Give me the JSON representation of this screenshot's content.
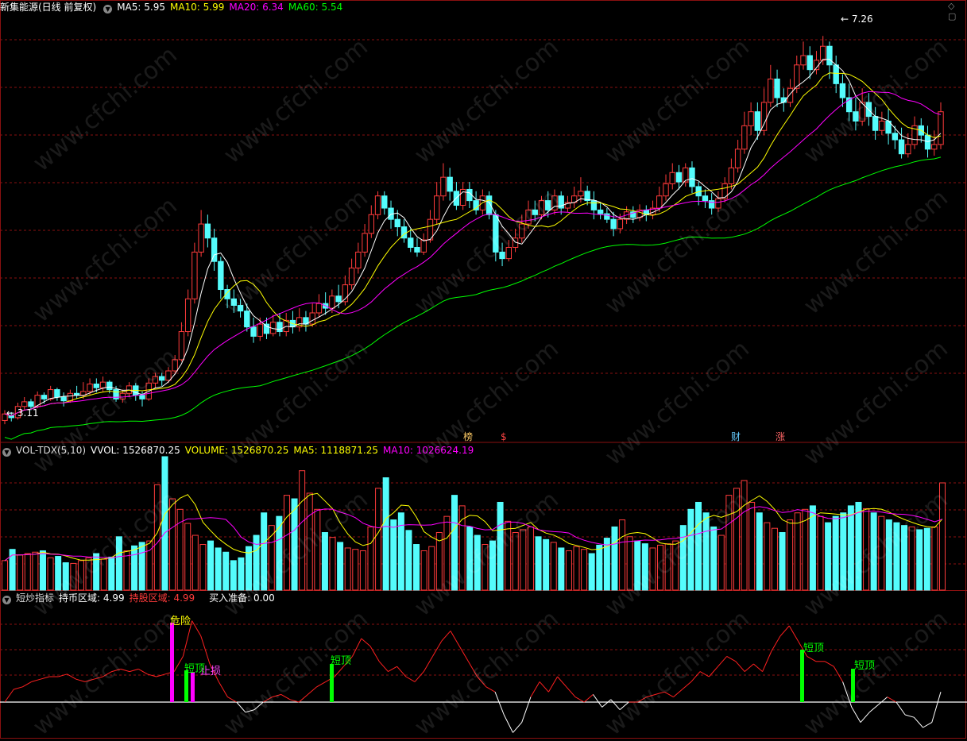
{
  "colors": {
    "up": "#ff3b3b",
    "down": "#54fcfc",
    "ma5": "#ffffff",
    "ma10": "#ffff00",
    "ma20": "#ff00ff",
    "ma60": "#00ff00",
    "grid": "#8a1010",
    "hdr_label": "#ffffff"
  },
  "header_main": {
    "stock": "新集能源(日线 前复权)",
    "ma5": "MA5: 5.95",
    "ma10": "MA10: 5.99",
    "ma20": "MA20: 6.34",
    "ma60": "MA60: 5.54"
  },
  "header_vol": {
    "name": "VOL-TDX(5,10)",
    "vvol": "VVOL: 1526870.25",
    "volume": "VOLUME: 1526870.25",
    "ma5": "MA5: 1118871.25",
    "ma10": "MA10: 1026624.19"
  },
  "header_ind": {
    "name": "短炒指标",
    "hold_coin": "持币区域: 4.99",
    "hold_stock": "持股区域: 4.99",
    "buy": "买入准备: 0.00"
  },
  "watermark": "www.cfchi.com",
  "chart_data": [
    {
      "type": "candlestick",
      "max_label": "7.26",
      "min_label": "3.11",
      "event_labels": [
        "榜",
        "$",
        "财",
        "涨"
      ],
      "candles": [
        [
          3.15,
          3.22,
          3.11,
          3.26
        ],
        [
          3.2,
          3.18,
          3.14,
          3.24
        ],
        [
          3.18,
          3.3,
          3.16,
          3.34
        ],
        [
          3.3,
          3.35,
          3.27,
          3.4
        ],
        [
          3.35,
          3.3,
          3.26,
          3.38
        ],
        [
          3.3,
          3.42,
          3.28,
          3.46
        ],
        [
          3.42,
          3.38,
          3.33,
          3.45
        ],
        [
          3.38,
          3.48,
          3.36,
          3.52
        ],
        [
          3.48,
          3.4,
          3.36,
          3.5
        ],
        [
          3.4,
          3.36,
          3.3,
          3.45
        ],
        [
          3.36,
          3.44,
          3.34,
          3.48
        ],
        [
          3.44,
          3.42,
          3.38,
          3.52
        ],
        [
          3.42,
          3.46,
          3.38,
          3.56
        ],
        [
          3.46,
          3.54,
          3.42,
          3.6
        ],
        [
          3.54,
          3.5,
          3.45,
          3.6
        ],
        [
          3.5,
          3.56,
          3.46,
          3.62
        ],
        [
          3.56,
          3.48,
          3.44,
          3.58
        ],
        [
          3.48,
          3.38,
          3.35,
          3.52
        ],
        [
          3.38,
          3.44,
          3.34,
          3.48
        ],
        [
          3.44,
          3.52,
          3.4,
          3.56
        ],
        [
          3.52,
          3.42,
          3.36,
          3.55
        ],
        [
          3.42,
          3.38,
          3.3,
          3.46
        ],
        [
          3.38,
          3.55,
          3.36,
          3.6
        ],
        [
          3.55,
          3.62,
          3.5,
          3.66
        ],
        [
          3.62,
          3.58,
          3.52,
          3.66
        ],
        [
          3.58,
          3.68,
          3.55,
          3.72
        ],
        [
          3.68,
          3.8,
          3.64,
          3.85
        ],
        [
          3.8,
          4.1,
          3.78,
          4.2
        ],
        [
          4.1,
          4.45,
          4.05,
          4.55
        ],
        [
          4.45,
          4.95,
          4.4,
          5.05
        ],
        [
          4.95,
          5.25,
          4.9,
          5.4
        ],
        [
          5.25,
          5.1,
          5.0,
          5.35
        ],
        [
          5.1,
          4.85,
          4.75,
          5.2
        ],
        [
          4.85,
          4.55,
          4.45,
          4.9
        ],
        [
          4.55,
          4.45,
          4.35,
          4.6
        ],
        [
          4.45,
          4.38,
          4.3,
          4.55
        ],
        [
          4.38,
          4.32,
          4.25,
          4.45
        ],
        [
          4.32,
          4.15,
          4.1,
          4.4
        ],
        [
          4.15,
          4.05,
          3.98,
          4.25
        ],
        [
          4.05,
          4.18,
          4.0,
          4.25
        ],
        [
          4.18,
          4.08,
          4.02,
          4.25
        ],
        [
          4.08,
          4.2,
          4.05,
          4.28
        ],
        [
          4.2,
          4.1,
          4.05,
          4.3
        ],
        [
          4.1,
          4.22,
          4.05,
          4.3
        ],
        [
          4.22,
          4.15,
          4.08,
          4.32
        ],
        [
          4.15,
          4.25,
          4.1,
          4.35
        ],
        [
          4.25,
          4.18,
          4.1,
          4.32
        ],
        [
          4.18,
          4.3,
          4.15,
          4.4
        ],
        [
          4.3,
          4.4,
          4.25,
          4.5
        ],
        [
          4.4,
          4.35,
          4.28,
          4.52
        ],
        [
          4.35,
          4.48,
          4.3,
          4.55
        ],
        [
          4.48,
          4.42,
          4.35,
          4.6
        ],
        [
          4.42,
          4.6,
          4.38,
          4.7
        ],
        [
          4.6,
          4.78,
          4.55,
          4.88
        ],
        [
          4.78,
          4.95,
          4.72,
          5.05
        ],
        [
          4.95,
          5.15,
          4.9,
          5.25
        ],
        [
          5.15,
          5.35,
          5.1,
          5.45
        ],
        [
          5.35,
          5.55,
          5.3,
          5.6
        ],
        [
          5.55,
          5.42,
          5.35,
          5.6
        ],
        [
          5.42,
          5.3,
          5.2,
          5.5
        ],
        [
          5.3,
          5.22,
          5.12,
          5.4
        ],
        [
          5.22,
          5.1,
          5.05,
          5.3
        ],
        [
          5.1,
          5.0,
          4.95,
          5.2
        ],
        [
          5.0,
          4.95,
          4.9,
          5.1
        ],
        [
          4.95,
          5.08,
          4.92,
          5.15
        ],
        [
          5.08,
          5.3,
          5.05,
          5.4
        ],
        [
          5.3,
          5.55,
          5.25,
          5.7
        ],
        [
          5.55,
          5.75,
          5.5,
          5.9
        ],
        [
          5.75,
          5.6,
          5.5,
          5.85
        ],
        [
          5.6,
          5.45,
          5.4,
          5.7
        ],
        [
          5.45,
          5.62,
          5.4,
          5.7
        ],
        [
          5.62,
          5.5,
          5.42,
          5.7
        ],
        [
          5.5,
          5.4,
          5.35,
          5.6
        ],
        [
          5.4,
          5.55,
          5.35,
          5.62
        ],
        [
          5.55,
          5.35,
          5.3,
          5.6
        ],
        [
          5.35,
          4.95,
          4.85,
          5.4
        ],
        [
          4.95,
          4.88,
          4.8,
          5.05
        ],
        [
          4.88,
          5.0,
          4.85,
          5.08
        ],
        [
          5.0,
          5.1,
          4.95,
          5.2
        ],
        [
          5.1,
          5.25,
          5.05,
          5.35
        ],
        [
          5.25,
          5.4,
          5.2,
          5.5
        ],
        [
          5.4,
          5.35,
          5.28,
          5.5
        ],
        [
          5.35,
          5.5,
          5.3,
          5.55
        ],
        [
          5.5,
          5.4,
          5.32,
          5.6
        ],
        [
          5.4,
          5.55,
          5.35,
          5.62
        ],
        [
          5.55,
          5.42,
          5.35,
          5.6
        ],
        [
          5.42,
          5.48,
          5.38,
          5.55
        ],
        [
          5.48,
          5.55,
          5.42,
          5.65
        ],
        [
          5.55,
          5.6,
          5.48,
          5.75
        ],
        [
          5.6,
          5.5,
          5.45,
          5.66
        ],
        [
          5.5,
          5.4,
          5.3,
          5.6
        ],
        [
          5.4,
          5.36,
          5.3,
          5.48
        ],
        [
          5.36,
          5.3,
          5.26,
          5.42
        ],
        [
          5.3,
          5.2,
          5.12,
          5.38
        ],
        [
          5.2,
          5.3,
          5.15,
          5.36
        ],
        [
          5.3,
          5.38,
          5.25,
          5.44
        ],
        [
          5.38,
          5.32,
          5.26,
          5.44
        ],
        [
          5.32,
          5.4,
          5.28,
          5.46
        ],
        [
          5.4,
          5.35,
          5.28,
          5.45
        ],
        [
          5.35,
          5.42,
          5.3,
          5.5
        ],
        [
          5.42,
          5.55,
          5.38,
          5.65
        ],
        [
          5.55,
          5.68,
          5.5,
          5.78
        ],
        [
          5.68,
          5.8,
          5.62,
          5.9
        ],
        [
          5.8,
          5.7,
          5.62,
          5.88
        ],
        [
          5.7,
          5.85,
          5.65,
          5.9
        ],
        [
          5.85,
          5.65,
          5.58,
          5.92
        ],
        [
          5.65,
          5.55,
          5.45,
          5.7
        ],
        [
          5.55,
          5.5,
          5.42,
          5.62
        ],
        [
          5.5,
          5.42,
          5.35,
          5.58
        ],
        [
          5.42,
          5.52,
          5.38,
          5.6
        ],
        [
          5.52,
          5.68,
          5.48,
          5.75
        ],
        [
          5.68,
          5.85,
          5.62,
          5.95
        ],
        [
          5.85,
          6.05,
          5.8,
          6.15
        ],
        [
          6.05,
          6.3,
          6.0,
          6.45
        ],
        [
          6.3,
          6.45,
          6.2,
          6.55
        ],
        [
          6.45,
          6.25,
          6.15,
          6.55
        ],
        [
          6.25,
          6.55,
          6.2,
          6.7
        ],
        [
          6.55,
          6.8,
          6.5,
          6.95
        ],
        [
          6.8,
          6.6,
          6.5,
          6.9
        ],
        [
          6.6,
          6.55,
          6.45,
          6.7
        ],
        [
          6.55,
          6.7,
          6.5,
          6.8
        ],
        [
          6.7,
          6.95,
          6.65,
          7.05
        ],
        [
          6.95,
          7.05,
          6.9,
          7.2
        ],
        [
          7.05,
          6.9,
          6.8,
          7.15
        ],
        [
          6.9,
          7.0,
          6.85,
          7.1
        ],
        [
          7.0,
          7.15,
          6.95,
          7.26
        ],
        [
          7.15,
          6.95,
          6.8,
          7.2
        ],
        [
          6.95,
          6.75,
          6.65,
          7.05
        ],
        [
          6.75,
          6.6,
          6.5,
          6.85
        ],
        [
          6.6,
          6.45,
          6.35,
          6.75
        ],
        [
          6.45,
          6.35,
          6.25,
          6.6
        ],
        [
          6.35,
          6.55,
          6.3,
          6.7
        ],
        [
          6.55,
          6.4,
          6.3,
          6.65
        ],
        [
          6.4,
          6.25,
          6.15,
          6.5
        ],
        [
          6.25,
          6.35,
          6.2,
          6.45
        ],
        [
          6.35,
          6.22,
          6.1,
          6.48
        ],
        [
          6.22,
          6.15,
          6.05,
          6.3
        ],
        [
          6.15,
          6.0,
          5.95,
          6.28
        ],
        [
          6.0,
          6.1,
          5.96,
          6.22
        ],
        [
          6.1,
          6.3,
          6.05,
          6.4
        ],
        [
          6.3,
          6.2,
          6.12,
          6.38
        ],
        [
          6.2,
          6.05,
          5.96,
          6.3
        ],
        [
          6.05,
          6.1,
          5.98,
          6.25
        ],
        [
          6.1,
          6.45,
          6.05,
          6.55
        ]
      ],
      "ymin": 2.95,
      "ymax": 7.5
    },
    {
      "type": "bar",
      "series_name": "VOLUME",
      "ymax": 1900000,
      "values": [
        420000,
        580000,
        500000,
        520000,
        540000,
        560000,
        460000,
        480000,
        390000,
        380000,
        420000,
        460000,
        520000,
        440000,
        470000,
        760000,
        560000,
        630000,
        680000,
        700000,
        1500000,
        1900000,
        1300000,
        1150000,
        950000,
        780000,
        650000,
        700000,
        600000,
        540000,
        420000,
        460000,
        620000,
        780000,
        1100000,
        920000,
        1050000,
        1350000,
        1300000,
        1700000,
        1380000,
        1150000,
        820000,
        750000,
        680000,
        600000,
        580000,
        560000,
        900000,
        1450000,
        1600000,
        1000000,
        1100000,
        850000,
        650000,
        560000,
        620000,
        820000,
        1050000,
        1350000,
        1200000,
        900000,
        780000,
        650000,
        700000,
        1250000,
        980000,
        820000,
        860000,
        900000,
        760000,
        720000,
        680000,
        600000,
        560000,
        620000,
        580000,
        520000,
        640000,
        740000,
        900000,
        1000000,
        760000,
        700000,
        660000,
        600000,
        640000,
        660000,
        700000,
        920000,
        1150000,
        1250000,
        1100000,
        900000,
        780000,
        1350000,
        1450000,
        1560000,
        1250000,
        1100000,
        960000,
        880000,
        820000,
        1000000,
        1100000,
        1150000,
        1200000,
        1050000,
        960000,
        1050000,
        1100000,
        1200000,
        1250000,
        1160000,
        1100000,
        1050000,
        1000000,
        960000,
        920000,
        900000,
        860000,
        880000,
        900000,
        1526870
      ],
      "ma5": "MA5: 1118871.25",
      "ma10": "MA10: 1026624.19"
    },
    {
      "type": "line",
      "series_name": "短炒指标",
      "annotations": [
        "危险",
        "短顶",
        "止损",
        "短顶",
        "短顶",
        "短顶"
      ],
      "values": [
        0.0,
        0.5,
        0.6,
        0.8,
        0.9,
        1.0,
        1.0,
        1.1,
        0.9,
        0.8,
        0.9,
        1.0,
        1.2,
        1.3,
        1.2,
        1.3,
        1.1,
        1.0,
        1.1,
        1.2,
        1.8,
        3.2,
        2.6,
        1.5,
        0.8,
        0.2,
        0.0,
        -0.4,
        -0.3,
        0.0,
        0.2,
        0.3,
        0.1,
        0.0,
        0.3,
        0.6,
        0.8,
        1.0,
        1.4,
        1.8,
        2.5,
        2.2,
        1.6,
        1.2,
        1.4,
        1.0,
        0.8,
        1.2,
        1.8,
        2.4,
        2.8,
        2.2,
        1.6,
        1.0,
        0.6,
        0.4,
        -0.5,
        -1.2,
        -0.8,
        0.2,
        0.8,
        0.4,
        1.0,
        0.6,
        0.2,
        0.0,
        0.3,
        -0.2,
        0.1,
        -0.3,
        0.0,
        0.0,
        0.2,
        0.3,
        0.4,
        0.2,
        0.5,
        0.8,
        1.2,
        1.0,
        1.4,
        1.8,
        1.6,
        1.2,
        1.5,
        1.2,
        2.0,
        2.6,
        3.0,
        2.4,
        1.8,
        1.6,
        1.6,
        1.4,
        0.8,
        -0.2,
        -0.8,
        -0.4,
        -0.1,
        0.2,
        0.0,
        -0.5,
        -0.6,
        -1.0,
        -0.8,
        0.4
      ]
    }
  ]
}
